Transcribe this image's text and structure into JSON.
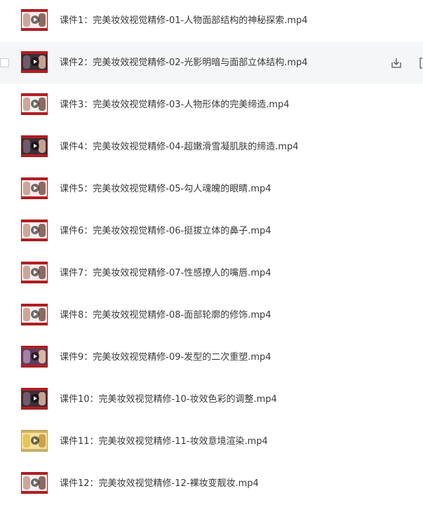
{
  "files": [
    {
      "name": "课件1：完美妆效视觉精修-01-人物面部结构的神秘探索.mp4",
      "thumb_icon": "video-thumbnail"
    },
    {
      "name": "课件2：完美妆效视觉精修-02-光影明暗与面部立体结构.mp4",
      "thumb_icon": "video-thumbnail"
    },
    {
      "name": "课件3：完美妆效视觉精修-03-人物形体的完美缔造.mp4",
      "thumb_icon": "video-thumbnail"
    },
    {
      "name": "课件4：完美妆效视觉精修-04-超嫩滑雪凝肌肤的缔造.mp4",
      "thumb_icon": "video-thumbnail"
    },
    {
      "name": "课件5：完美妆效视觉精修-05-勾人魂魄的眼睛.mp4",
      "thumb_icon": "video-thumbnail"
    },
    {
      "name": "课件6：完美妆效视觉精修-06-挺拔立体的鼻子.mp4",
      "thumb_icon": "video-thumbnail"
    },
    {
      "name": "课件7：完美妆效视觉精修-07-性感撩人的嘴唇.mp4",
      "thumb_icon": "video-thumbnail"
    },
    {
      "name": "课件8：完美妆效视觉精修-08-面部轮廓的修饰.mp4",
      "thumb_icon": "video-thumbnail"
    },
    {
      "name": "课件9：完美妆效视觉精修-09-发型的二次重塑.mp4",
      "thumb_icon": "video-thumbnail"
    },
    {
      "name": "课件10：完美妆效视觉精修-10-妆效色彩的调整.mp4",
      "thumb_icon": "video-thumbnail"
    },
    {
      "name": "课件11：完美妆效视觉精修-11-妆效意境渲染.mp4",
      "thumb_icon": "video-thumbnail"
    },
    {
      "name": "课件12：完美妆效视觉精修-12-裸妆变靓妆.mp4",
      "thumb_icon": "video-thumbnail"
    }
  ],
  "hovered_row_index": 1,
  "row_actions": {
    "download_icon": "download-icon",
    "more_icon": "more-icon"
  },
  "colors": {
    "hover_bg": "#f5f6f7",
    "text": "#3a3a3a",
    "thumb_border": "#9e1b1b"
  }
}
